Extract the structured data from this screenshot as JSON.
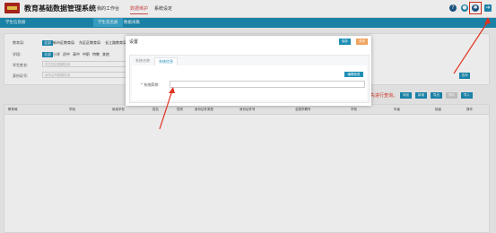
{
  "header": {
    "app_title": "教育基础数据管理系统",
    "nav": [
      "我的工作台",
      "数据维护",
      "系统设定"
    ],
    "active_nav": "数据维护",
    "icons": [
      "help-icon",
      "bell-icon",
      "gear-icon",
      "logout-icon"
    ]
  },
  "subnav": {
    "items": [
      "学生信息册",
      "学生花名册",
      "数据采集"
    ],
    "active": "学生花名册"
  },
  "filters": {
    "row1_label": "教育局:",
    "row1_chips": [
      "全部",
      "新市区教育局",
      "东区区教育局",
      "长江路教育局"
    ],
    "row2_label": "学段:",
    "row2_chips": [
      "全部",
      "小学",
      "初中",
      "高中",
      "中职",
      "特教",
      "其他"
    ],
    "row3_label": "学生姓名:",
    "row3_placeholder": "学生姓名模糊查询",
    "row4_label": "身份证号:",
    "row4_placeholder": "身份证号模糊查询",
    "search_label": "查询"
  },
  "toolbar": {
    "hint": "请先进行查询。",
    "buttons": [
      "添加",
      "新增",
      "导出",
      "删除",
      "导入"
    ]
  },
  "table": {
    "columns": [
      "教育局",
      "学段",
      "就读学校",
      "姓名",
      "性别",
      "身份证件类型",
      "身份证件号",
      "全国学籍号",
      "学校",
      "年级",
      "班级",
      "操作"
    ]
  },
  "dialog": {
    "title": "设置",
    "confirm_label": "保存",
    "close_label": "关闭",
    "tabs": [
      "系统名称",
      "系统信息"
    ],
    "active_tab": "系统信息",
    "edit_label": "编辑信息",
    "field_label": "* 系统简称:",
    "field_value": ""
  },
  "colors": {
    "accent": "#1c8db5",
    "alert": "#e0321f"
  }
}
